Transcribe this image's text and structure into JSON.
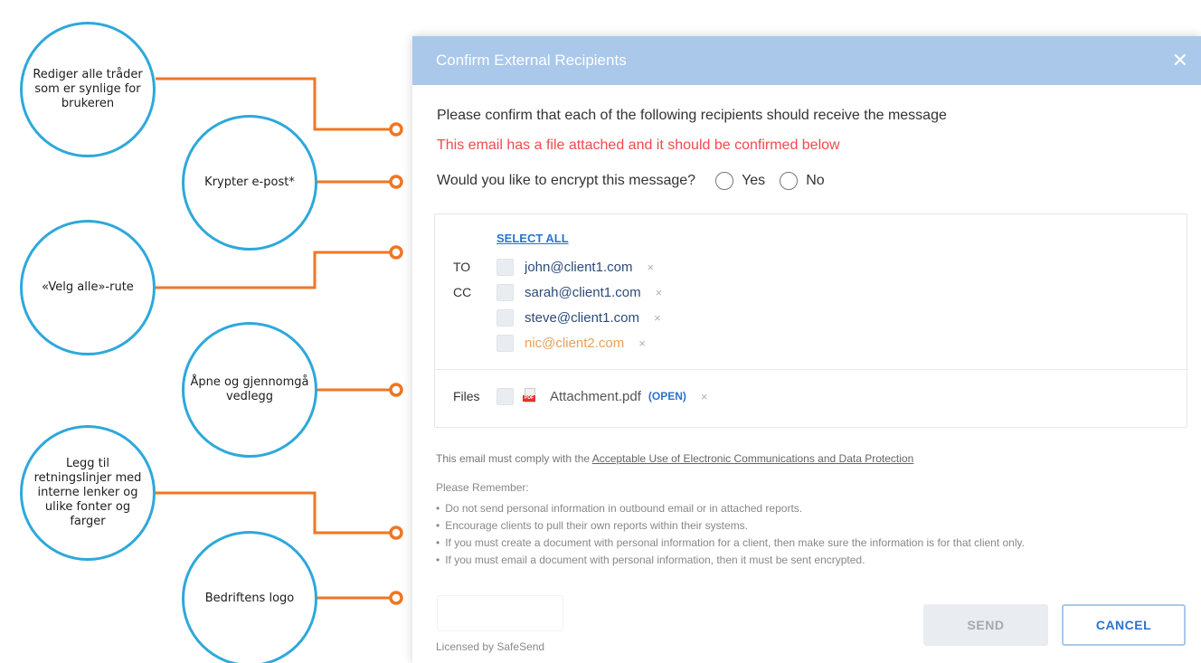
{
  "annotations": {
    "edit_text": "Rediger alle tråder som er synlige for brukeren",
    "encrypt": "Krypter e-post*",
    "select_all": "«Velg alle»-rute",
    "attachment": "Åpne og gjennomgå vedlegg",
    "policy": "Legg til retningslinjer med interne lenker og ulike fonter og farger",
    "logo": "Bedriftens logo"
  },
  "colors": {
    "header_bg": "#a9c8ea",
    "annotation_circle": "#2ea8db",
    "connector": "#f07623",
    "warning_text": "#f24a4a",
    "link": "#2a73d0",
    "external_email": "#e9a05a"
  },
  "dialog": {
    "title": "Confirm External Recipients",
    "close_icon": "close-icon",
    "confirm_text": "Please confirm that each of the following recipients should receive the message",
    "warning_text": "This email has a file attached and it should be confirmed below",
    "encrypt_question": "Would you like to encrypt this message?",
    "encrypt_options": [
      "Yes",
      "No"
    ],
    "select_all": "SELECT ALL",
    "recipients": [
      {
        "type": "TO",
        "email": "john@client1.com"
      },
      {
        "type": "CC",
        "email": "sarah@client1.com"
      },
      {
        "type": "",
        "email": "steve@client1.com"
      },
      {
        "type": "",
        "email": "nic@client2.com"
      }
    ],
    "files_label": "Files",
    "file_name": "Attachment.pdf",
    "open_label": "(OPEN)",
    "remove_icon": "×",
    "policy_prefix": "This email must comply with the ",
    "policy_link": "Acceptable Use of Electronic Communications and Data Protection",
    "remember_title": "Please Remember:",
    "remember_items": [
      "Do not send personal information in outbound email or in attached reports.",
      "Encourage clients to pull their own reports within their systems.",
      "If you must create a document with personal information for a client, then make sure the information is for that client only.",
      "If you must email a document with personal information, then it must be sent encrypted."
    ],
    "licensed": "Licensed by SafeSend",
    "send_label": "SEND",
    "cancel_label": "CANCEL"
  }
}
